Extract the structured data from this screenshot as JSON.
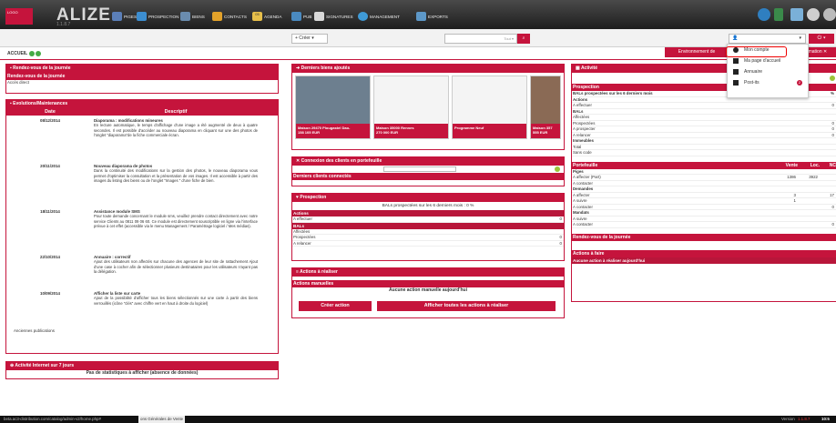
{
  "app": {
    "brand": "ALIZE",
    "brand_sub": "1.1.8.7",
    "logo_text": "LOGO"
  },
  "nav": [
    "PIGES",
    "PROSPECTION",
    "BIENS",
    "CONTACTS",
    "AGENDA",
    "PUB",
    "SIGNATURES",
    "MANAGEMENT",
    "EXPORTS"
  ],
  "agenda_day": "05",
  "toolbar": {
    "create_label": "+ Créer ▾",
    "search_placeholder": "Tout ▾",
    "user_label": "👤",
    "user_caret": "▾",
    "power_label": "⏻ ▾"
  },
  "tabs": {
    "env": "Environnement de",
    "info": "formation ✕",
    "accueil": "ACCUEIL"
  },
  "dropdown": [
    {
      "label": "Mon compte"
    },
    {
      "label": "Ma page d'accueil"
    },
    {
      "label": "Annuaire"
    },
    {
      "label": "Post-its",
      "badge": "2"
    }
  ],
  "rdv": {
    "title": "Rendez-vous de la journée",
    "sub": "Rendez-vous de la journée",
    "link": "Accès direct"
  },
  "evo": {
    "title": "Evolutions/Maintenances",
    "col_date": "Date",
    "col_desc": "Descriptif",
    "items": [
      {
        "date": "08/12/2014",
        "title": "Diaporama : modifications mineures",
        "text": "En lecture automatique, le temps d'affichage d'une image a été augmenté de deux à quatre secondes. Il est possible d'accéder au nouveau diaporama en cliquant sur une des photos de l'onglet \"diaporama\"de la fiche commerciale écran."
      },
      {
        "date": "20/11/2014",
        "title": "Nouveau diaporama de photos",
        "text": "Dans la continuité des modifications sur la gestion des photos, le nouveau diaporama vous permet d'optimiser la consultation et la présentation de vos images. Il est accessible à partir des images du listing des biens ou de l'onglet \"Images \" d'une fiche de bien."
      },
      {
        "date": "18/11/2014",
        "title": "Assistance module SMS",
        "text": "Pour toute demande concernant le module sms, veuillez prendre contact directement avec notre service Clients au 0811 09 06 60. Ce module est directement souscriptible en ligne via l'interface prévue à cet effet (accessible via le menu Management / Paramétrage logiciel / Mes médias)."
      },
      {
        "date": "22/10/2014",
        "title": "Annuaire : correctif",
        "text": "Ajout des utilisateurs non affectés sur chacune des agences de leur site de rattachement Ajout d'une case à cocher afin de sélectionner plusieurs destinataires pour les utilisateurs n'ayant pas la délégation."
      },
      {
        "date": "10/09/2014",
        "title": "Afficher la liste sur carte",
        "text": "Ajout de la possibilité d'afficher tous les biens sélectionnés sur une carte à partir des biens verrouillés (icône \"clés\" avec chiffre vert en haut à droite du logiciel)"
      }
    ],
    "old": "Anciennes publications"
  },
  "web": {
    "title": "Activité Internet sur 7 jours",
    "text": "Pas de statistiques à afficher (absence de données)"
  },
  "biens": {
    "title": "Derniers biens ajoutés",
    "items": [
      {
        "caption": "Maison 29470 Plougastel Dao-\n158 105 EUR"
      },
      {
        "caption": "Maison 35000 Rennes\n270 000 EUR"
      },
      {
        "caption": "Programme Neuf"
      },
      {
        "caption": "Maison 357\n555 EUR"
      }
    ]
  },
  "connexion": {
    "title": "Connexion des clients en portefeuille",
    "sub": "Derniers clients connectés"
  },
  "prospection": {
    "title": "Prospection",
    "summary": "BALs prospectées sur les 6 derniers mois : 0 %",
    "actions_label": "Actions",
    "a_effectuer": "A effectuer",
    "a_effectuer_v": "0",
    "bals_label": "BALs",
    "rows": [
      {
        "label": "Affectées",
        "v": ""
      },
      {
        "label": "Prospectées",
        "v": "0"
      },
      {
        "label": "A relancer",
        "v": "0"
      }
    ]
  },
  "actions": {
    "title": "Actions à réaliser",
    "sub": "Actions manuelles",
    "empty": "Aucune action manuelle aujourd'hui",
    "btn_create": "Créer action",
    "btn_all": "Afficher toutes les actions à réaliser"
  },
  "activite": {
    "title": "Activité",
    "pct_hdr": "%",
    "prospection_hdr": "Prospection",
    "bals_hdr": "BALs prospectées sur les 6 derniers mois",
    "actions": "Actions",
    "a_effectuer": "A effectuer",
    "a_effectuer_v": "0",
    "bals": "BALs",
    "bals_rows": [
      {
        "label": "Affectées",
        "v": ""
      },
      {
        "label": "Prospectées",
        "v": "0"
      },
      {
        "label": "A prospecter",
        "v": "0"
      },
      {
        "label": "A relancer",
        "v": "0"
      }
    ],
    "immeubles": "Immeubles",
    "imm_rows": [
      "Total",
      "Sans code"
    ],
    "portefeuille": "Portefeuille",
    "col_vente": "Vente",
    "col_loc": "Loc.",
    "col_nc": "NC",
    "groups": [
      {
        "name": "Piges",
        "rows": [
          {
            "label": "A affecter (Part)",
            "v": [
              "1386",
              "3922",
              ""
            ]
          },
          {
            "label": "A contacter",
            "v": [
              "",
              "",
              ""
            ]
          }
        ]
      },
      {
        "name": "Demandes",
        "rows": [
          {
            "label": "A affecter",
            "v": [
              "3",
              "",
              "17"
            ]
          },
          {
            "label": "A suivre",
            "v": [
              "1",
              "",
              ""
            ]
          },
          {
            "label": "A contacter",
            "v": [
              "",
              "",
              "0"
            ]
          }
        ]
      },
      {
        "name": "Mandats",
        "rows": [
          {
            "label": "A suivre",
            "v": [
              "",
              "",
              ""
            ]
          },
          {
            "label": "A contacter",
            "v": [
              "",
              "",
              "0"
            ]
          }
        ]
      }
    ],
    "rdv": "Rendez-vous de la journée",
    "actions_faire": "Actions à faire",
    "aucune": "Aucune action à réaliser aujourd'hui"
  },
  "status": {
    "url": "beta.ac3-distribution.com/catalog/admin-v2/home.php#",
    "cgv": "ons Générales de Vente",
    "version_label": "Version",
    "version": "1.1.8.7",
    "time": "10:5"
  },
  "colors": {
    "accent": "#c5143c",
    "topbar": "#2b2b2b"
  }
}
